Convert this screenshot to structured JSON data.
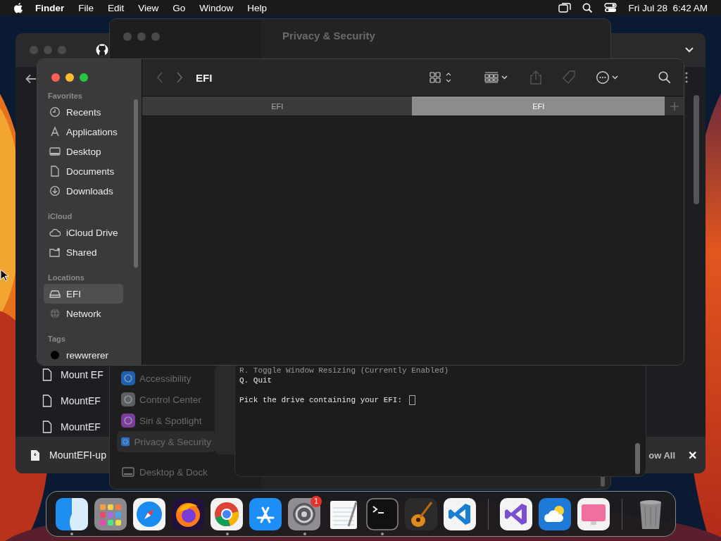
{
  "menu_bar": {
    "app_name": "Finder",
    "menus": [
      "File",
      "Edit",
      "View",
      "Go",
      "Window",
      "Help"
    ],
    "clock": "Fri Jul 28  6:42 AM"
  },
  "browser_window": {
    "file_rows": [
      "Mount EF",
      "MountEF",
      "MountEF"
    ],
    "download": {
      "file_name": "MountEFI-up",
      "show_all": "ow All",
      "close": "✕"
    }
  },
  "settings_window": {
    "title": "Privacy & Security",
    "sidebar_items": [
      {
        "label": "Accessibility",
        "selected": false
      },
      {
        "label": "Control Center",
        "selected": false
      },
      {
        "label": "Siri & Spotlight",
        "selected": false
      },
      {
        "label": "Privacy & Security",
        "selected": true
      },
      {
        "label": "Desktop & Dock",
        "selected": false
      }
    ]
  },
  "terminal": {
    "lines": [
      {
        "text": "R. Toggle Window Resizing (Currently Enabled)",
        "kind": "output",
        "dim": true
      },
      {
        "text": "Q. Quit",
        "kind": "output",
        "dim": false
      },
      {
        "text": "Pick the drive containing your EFI:",
        "kind": "prompt",
        "dim": false
      }
    ]
  },
  "finder": {
    "title": "EFI",
    "tabs": [
      {
        "label": "EFI",
        "selected": false
      },
      {
        "label": "EFI",
        "selected": true
      }
    ],
    "sidebar": [
      {
        "heading": "Favorites",
        "items": [
          {
            "label": "Recents",
            "selected": false
          },
          {
            "label": "Applications",
            "selected": false
          },
          {
            "label": "Desktop",
            "selected": false
          },
          {
            "label": "Documents",
            "selected": false
          },
          {
            "label": "Downloads",
            "selected": false
          }
        ]
      },
      {
        "heading": "iCloud",
        "items": [
          {
            "label": "iCloud Drive",
            "selected": false
          },
          {
            "label": "Shared",
            "selected": false
          }
        ]
      },
      {
        "heading": "Locations",
        "items": [
          {
            "label": "EFI",
            "selected": true
          },
          {
            "label": "Network",
            "selected": false
          }
        ]
      },
      {
        "heading": "Tags",
        "items": [
          {
            "label": "rewwrerer",
            "selected": false,
            "color": "#000000"
          }
        ]
      }
    ]
  },
  "dock": {
    "apps": [
      {
        "kind": "finder",
        "running": true
      },
      {
        "kind": "launchpad",
        "running": false
      },
      {
        "kind": "safari",
        "running": false
      },
      {
        "kind": "firefox",
        "running": false
      },
      {
        "kind": "chrome",
        "running": true
      },
      {
        "kind": "appstore",
        "running": false
      },
      {
        "kind": "settings",
        "running": true,
        "badge": "1"
      },
      {
        "kind": "textedit",
        "running": false
      },
      {
        "kind": "terminal",
        "running": true
      },
      {
        "kind": "garageband",
        "running": false
      },
      {
        "kind": "vscode",
        "running": false
      },
      {
        "kind": "divider"
      },
      {
        "kind": "visualstudio",
        "running": false
      },
      {
        "kind": "weather",
        "running": false
      },
      {
        "kind": "cleaner",
        "running": false
      },
      {
        "kind": "divider"
      },
      {
        "kind": "trash",
        "running": false
      }
    ]
  }
}
